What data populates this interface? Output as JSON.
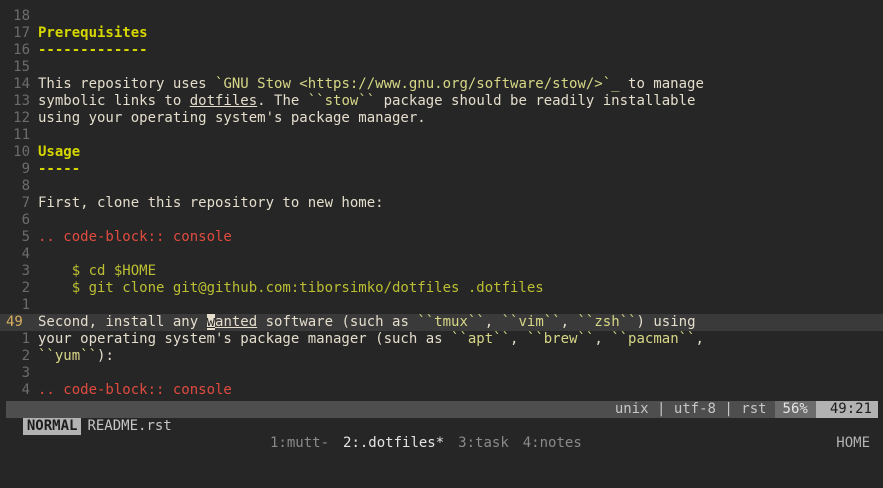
{
  "editor": {
    "lines": [
      {
        "num": "18",
        "segments": []
      },
      {
        "num": "17",
        "segments": [
          {
            "t": "Prerequisites",
            "c": "heading"
          }
        ]
      },
      {
        "num": "16",
        "segments": [
          {
            "t": "-------------",
            "c": "underline-rule"
          }
        ]
      },
      {
        "num": "15",
        "segments": []
      },
      {
        "num": "14",
        "segments": [
          {
            "t": "This repository uses ",
            "c": "text"
          },
          {
            "t": "`GNU Stow <https://www.gnu.org/software/stow/>`_",
            "c": "lit"
          },
          {
            "t": " to manage",
            "c": "text"
          }
        ]
      },
      {
        "num": "13",
        "segments": [
          {
            "t": "symbolic links to ",
            "c": "text"
          },
          {
            "t": "dotfiles",
            "c": "text u"
          },
          {
            "t": ". The ",
            "c": "text"
          },
          {
            "t": "``stow``",
            "c": "lit"
          },
          {
            "t": " package should be readily installable",
            "c": "text"
          }
        ]
      },
      {
        "num": "12",
        "segments": [
          {
            "t": "using your operating system's package manager.",
            "c": "text"
          }
        ]
      },
      {
        "num": "11",
        "segments": []
      },
      {
        "num": "10",
        "segments": [
          {
            "t": "Usage",
            "c": "heading"
          }
        ]
      },
      {
        "num": "9",
        "segments": [
          {
            "t": "-----",
            "c": "underline-rule"
          }
        ]
      },
      {
        "num": "8",
        "segments": []
      },
      {
        "num": "7",
        "segments": [
          {
            "t": "First, clone this repository to new home:",
            "c": "text"
          }
        ]
      },
      {
        "num": "6",
        "segments": []
      },
      {
        "num": "5",
        "segments": [
          {
            "t": ".. code-block:: console",
            "c": "code-dir"
          }
        ]
      },
      {
        "num": "4",
        "segments": []
      },
      {
        "num": "3",
        "segments": [
          {
            "t": "    $ cd $HOME",
            "c": "code"
          }
        ]
      },
      {
        "num": "2",
        "segments": [
          {
            "t": "    $ git clone git@github.com:tiborsimko/dotfiles .dotfiles",
            "c": "code"
          }
        ]
      },
      {
        "num": "1",
        "segments": []
      },
      {
        "num": "49",
        "current": true,
        "segments": [
          {
            "t": "Second, install any ",
            "c": "text"
          },
          {
            "t": "w",
            "c": "cursor"
          },
          {
            "t": "anted",
            "c": "text u"
          },
          {
            "t": " software (such as ",
            "c": "text"
          },
          {
            "t": "``tmux``",
            "c": "lit"
          },
          {
            "t": ", ",
            "c": "text"
          },
          {
            "t": "``vim``",
            "c": "lit"
          },
          {
            "t": ", ",
            "c": "text"
          },
          {
            "t": "``zsh``",
            "c": "lit"
          },
          {
            "t": ") using",
            "c": "text"
          }
        ]
      },
      {
        "num": "1",
        "segments": [
          {
            "t": "your operating system's package manager (such as ",
            "c": "text"
          },
          {
            "t": "``apt``",
            "c": "lit"
          },
          {
            "t": ", ",
            "c": "text"
          },
          {
            "t": "``brew``",
            "c": "lit"
          },
          {
            "t": ", ",
            "c": "text"
          },
          {
            "t": "``pacman``",
            "c": "lit"
          },
          {
            "t": ",",
            "c": "text"
          }
        ]
      },
      {
        "num": "2",
        "segments": [
          {
            "t": "``yum``",
            "c": "lit"
          },
          {
            "t": "):",
            "c": "text"
          }
        ]
      },
      {
        "num": "3",
        "segments": []
      },
      {
        "num": "4",
        "segments": [
          {
            "t": ".. code-block:: console",
            "c": "code-dir"
          }
        ]
      }
    ]
  },
  "statusline": {
    "mode": "NORMAL",
    "filename": "README.rst",
    "fileformat": "unix | utf-8 | rst",
    "percent": "56%",
    "position": "49:21"
  },
  "tmux": {
    "windows": [
      {
        "label": "1:mutt-",
        "active": false
      },
      {
        "label": "2:.dotfiles*",
        "active": true
      },
      {
        "label": "3:task",
        "active": false
      },
      {
        "label": "4:notes",
        "active": false
      }
    ],
    "host": "HOME"
  }
}
